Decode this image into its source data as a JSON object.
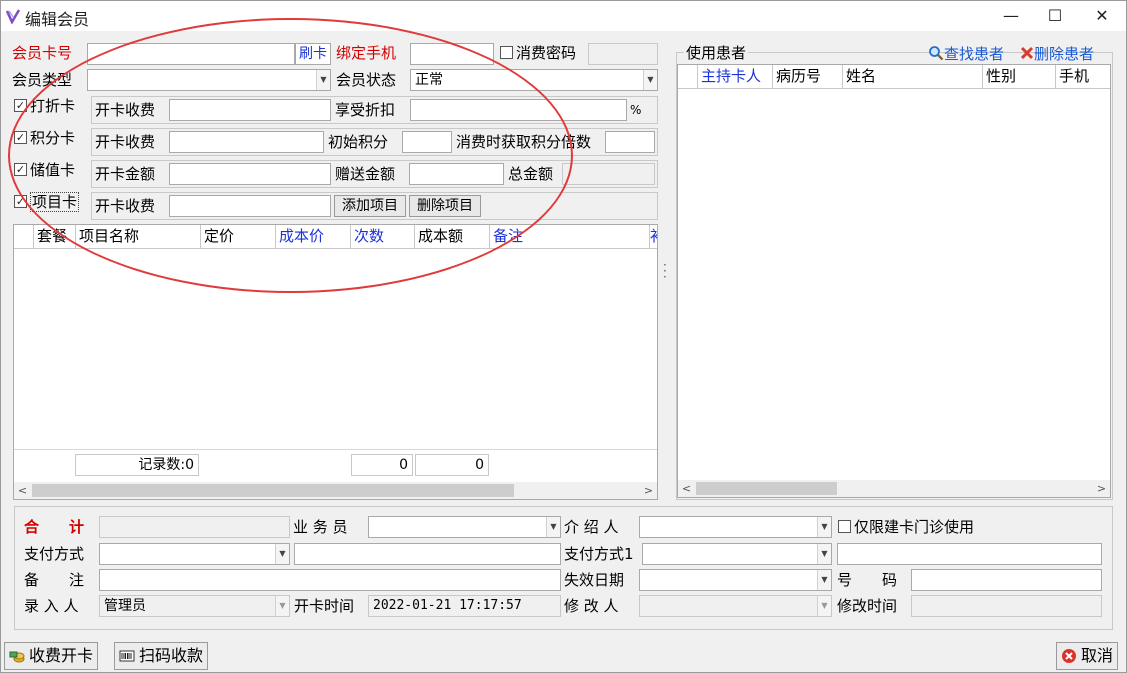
{
  "window": {
    "title": "编辑会员",
    "minimize": "—",
    "maximize": "☐",
    "close": "✕"
  },
  "member": {
    "card_no_label": "会员卡号",
    "card_no_value": "",
    "swipe_button": "刷卡",
    "bind_phone_label": "绑定手机",
    "bind_phone_value": "",
    "consume_pwd_label": "消费密码",
    "consume_pwd_checked": false,
    "type_label": "会员类型",
    "type_value": "",
    "status_label": "会员状态",
    "status_value": "正常"
  },
  "cards": {
    "discount": {
      "label": "打折卡",
      "checked": true,
      "fee_label": "开卡收费",
      "fee_value": "",
      "discount_label": "享受折扣",
      "discount_value": "",
      "percent": "%"
    },
    "points": {
      "label": "积分卡",
      "checked": true,
      "fee_label": "开卡收费",
      "fee_value": "",
      "init_label": "初始积分",
      "init_value": "",
      "multiplier_label": "消费时获取积分倍数",
      "multiplier_value": ""
    },
    "stored": {
      "label": "储值卡",
      "checked": true,
      "amount_label": "开卡金额",
      "amount_value": "",
      "gift_label": "赠送金额",
      "gift_value": "",
      "total_label": "总金额",
      "total_value": ""
    },
    "project": {
      "label": "项目卡",
      "checked": true,
      "fee_label": "开卡收费",
      "fee_value": "",
      "add_button": "添加项目",
      "delete_button": "删除项目"
    }
  },
  "items_grid": {
    "columns": [
      {
        "label": "套餐",
        "color": "#000000"
      },
      {
        "label": "项目名称",
        "color": "#000000"
      },
      {
        "label": "定价",
        "color": "#000000"
      },
      {
        "label": "成本价",
        "color": "#1a32d6"
      },
      {
        "label": "次数",
        "color": "#1a32d6"
      },
      {
        "label": "成本额",
        "color": "#000000"
      },
      {
        "label": "备注",
        "color": "#1a32d6"
      },
      {
        "label": "补",
        "color": "#1a32d6"
      }
    ],
    "rows": [],
    "record_count": "记录数:0",
    "sum1": "0",
    "sum2": "0"
  },
  "patients": {
    "group_label": "使用患者",
    "find_button": "查找患者",
    "delete_button": "删除患者",
    "columns": [
      {
        "label": "主持卡人",
        "color": "#1a32d6"
      },
      {
        "label": "病历号",
        "color": "#000000"
      },
      {
        "label": "姓名",
        "color": "#000000"
      },
      {
        "label": "性别",
        "color": "#000000"
      },
      {
        "label": "手机",
        "color": "#000000"
      }
    ],
    "rows": []
  },
  "footer": {
    "total_label": "合　　计",
    "total_value": "",
    "salesman_label": "业 务 员",
    "salesman_value": "",
    "referrer_label": "介 绍 人",
    "referrer_value": "",
    "clinic_only_label": "仅限建卡门诊使用",
    "clinic_only_checked": false,
    "pay_method_label": "支付方式",
    "pay_method_value": "",
    "pay_method_extra": "",
    "pay_method1_label": "支付方式1",
    "pay_method1_value": "",
    "pay_method1_extra": "",
    "remark_label": "备　　注",
    "remark_value": "",
    "expire_label": "失效日期",
    "expire_value": "",
    "number_label": "号　　码",
    "number_value": "",
    "entered_by_label": "录 入 人",
    "entered_by_value": "管理员",
    "open_time_label": "开卡时间",
    "open_time_value": "2022-01-21 17:17:57",
    "modified_by_label": "修 改 人",
    "modified_by_value": "",
    "modified_time_label": "修改时间",
    "modified_time_value": ""
  },
  "actions": {
    "charge_open": "收费开卡",
    "scan_pay": "扫码收款",
    "cancel": "取消"
  },
  "colors": {
    "red_label": "#d40000",
    "blue_label": "#1a32d6",
    "annotation_oval": "#e03a3a"
  }
}
